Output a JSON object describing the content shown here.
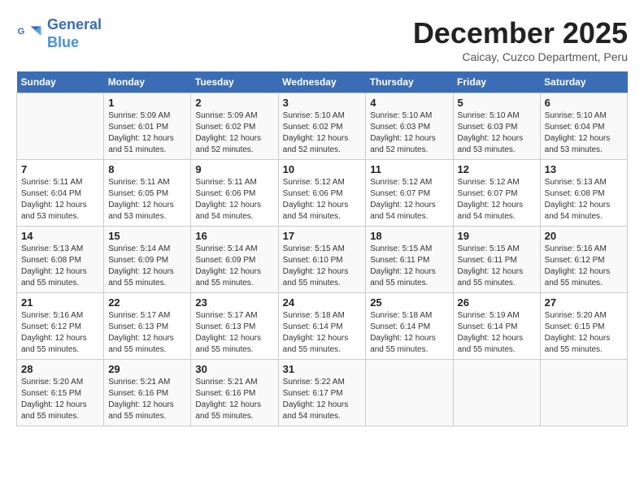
{
  "logo": {
    "line1": "General",
    "line2": "Blue"
  },
  "title": "December 2025",
  "subtitle": "Caicay, Cuzco Department, Peru",
  "weekdays": [
    "Sunday",
    "Monday",
    "Tuesday",
    "Wednesday",
    "Thursday",
    "Friday",
    "Saturday"
  ],
  "weeks": [
    [
      {
        "day": "",
        "info": ""
      },
      {
        "day": "1",
        "info": "Sunrise: 5:09 AM\nSunset: 6:01 PM\nDaylight: 12 hours\nand 51 minutes."
      },
      {
        "day": "2",
        "info": "Sunrise: 5:09 AM\nSunset: 6:02 PM\nDaylight: 12 hours\nand 52 minutes."
      },
      {
        "day": "3",
        "info": "Sunrise: 5:10 AM\nSunset: 6:02 PM\nDaylight: 12 hours\nand 52 minutes."
      },
      {
        "day": "4",
        "info": "Sunrise: 5:10 AM\nSunset: 6:03 PM\nDaylight: 12 hours\nand 52 minutes."
      },
      {
        "day": "5",
        "info": "Sunrise: 5:10 AM\nSunset: 6:03 PM\nDaylight: 12 hours\nand 53 minutes."
      },
      {
        "day": "6",
        "info": "Sunrise: 5:10 AM\nSunset: 6:04 PM\nDaylight: 12 hours\nand 53 minutes."
      }
    ],
    [
      {
        "day": "7",
        "info": "Sunrise: 5:11 AM\nSunset: 6:04 PM\nDaylight: 12 hours\nand 53 minutes."
      },
      {
        "day": "8",
        "info": "Sunrise: 5:11 AM\nSunset: 6:05 PM\nDaylight: 12 hours\nand 53 minutes."
      },
      {
        "day": "9",
        "info": "Sunrise: 5:11 AM\nSunset: 6:06 PM\nDaylight: 12 hours\nand 54 minutes."
      },
      {
        "day": "10",
        "info": "Sunrise: 5:12 AM\nSunset: 6:06 PM\nDaylight: 12 hours\nand 54 minutes."
      },
      {
        "day": "11",
        "info": "Sunrise: 5:12 AM\nSunset: 6:07 PM\nDaylight: 12 hours\nand 54 minutes."
      },
      {
        "day": "12",
        "info": "Sunrise: 5:12 AM\nSunset: 6:07 PM\nDaylight: 12 hours\nand 54 minutes."
      },
      {
        "day": "13",
        "info": "Sunrise: 5:13 AM\nSunset: 6:08 PM\nDaylight: 12 hours\nand 54 minutes."
      }
    ],
    [
      {
        "day": "14",
        "info": "Sunrise: 5:13 AM\nSunset: 6:08 PM\nDaylight: 12 hours\nand 55 minutes."
      },
      {
        "day": "15",
        "info": "Sunrise: 5:14 AM\nSunset: 6:09 PM\nDaylight: 12 hours\nand 55 minutes."
      },
      {
        "day": "16",
        "info": "Sunrise: 5:14 AM\nSunset: 6:09 PM\nDaylight: 12 hours\nand 55 minutes."
      },
      {
        "day": "17",
        "info": "Sunrise: 5:15 AM\nSunset: 6:10 PM\nDaylight: 12 hours\nand 55 minutes."
      },
      {
        "day": "18",
        "info": "Sunrise: 5:15 AM\nSunset: 6:11 PM\nDaylight: 12 hours\nand 55 minutes."
      },
      {
        "day": "19",
        "info": "Sunrise: 5:15 AM\nSunset: 6:11 PM\nDaylight: 12 hours\nand 55 minutes."
      },
      {
        "day": "20",
        "info": "Sunrise: 5:16 AM\nSunset: 6:12 PM\nDaylight: 12 hours\nand 55 minutes."
      }
    ],
    [
      {
        "day": "21",
        "info": "Sunrise: 5:16 AM\nSunset: 6:12 PM\nDaylight: 12 hours\nand 55 minutes."
      },
      {
        "day": "22",
        "info": "Sunrise: 5:17 AM\nSunset: 6:13 PM\nDaylight: 12 hours\nand 55 minutes."
      },
      {
        "day": "23",
        "info": "Sunrise: 5:17 AM\nSunset: 6:13 PM\nDaylight: 12 hours\nand 55 minutes."
      },
      {
        "day": "24",
        "info": "Sunrise: 5:18 AM\nSunset: 6:14 PM\nDaylight: 12 hours\nand 55 minutes."
      },
      {
        "day": "25",
        "info": "Sunrise: 5:18 AM\nSunset: 6:14 PM\nDaylight: 12 hours\nand 55 minutes."
      },
      {
        "day": "26",
        "info": "Sunrise: 5:19 AM\nSunset: 6:14 PM\nDaylight: 12 hours\nand 55 minutes."
      },
      {
        "day": "27",
        "info": "Sunrise: 5:20 AM\nSunset: 6:15 PM\nDaylight: 12 hours\nand 55 minutes."
      }
    ],
    [
      {
        "day": "28",
        "info": "Sunrise: 5:20 AM\nSunset: 6:15 PM\nDaylight: 12 hours\nand 55 minutes."
      },
      {
        "day": "29",
        "info": "Sunrise: 5:21 AM\nSunset: 6:16 PM\nDaylight: 12 hours\nand 55 minutes."
      },
      {
        "day": "30",
        "info": "Sunrise: 5:21 AM\nSunset: 6:16 PM\nDaylight: 12 hours\nand 55 minutes."
      },
      {
        "day": "31",
        "info": "Sunrise: 5:22 AM\nSunset: 6:17 PM\nDaylight: 12 hours\nand 54 minutes."
      },
      {
        "day": "",
        "info": ""
      },
      {
        "day": "",
        "info": ""
      },
      {
        "day": "",
        "info": ""
      }
    ]
  ]
}
